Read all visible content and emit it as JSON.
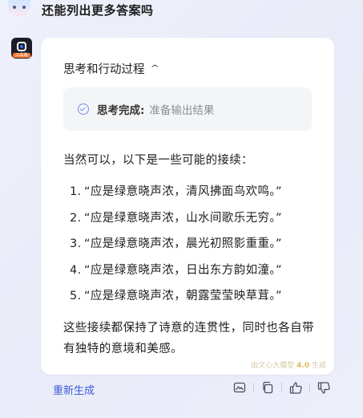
{
  "user_message": {
    "text": "还能列出更多答案吗"
  },
  "bot": {
    "avatar_tag": "工具版"
  },
  "thinking": {
    "header": "思考和行动过程",
    "status_label": "思考完成:",
    "status_value": "准备输出结果"
  },
  "answer": {
    "intro": "当然可以，以下是一些可能的接续：",
    "items": [
      {
        "num": "1.",
        "text": "“应是绿意晓声浓，清风拂面鸟欢鸣。”"
      },
      {
        "num": "2.",
        "text": "“应是绿意晓声浓，山水间歌乐无穷。”"
      },
      {
        "num": "3.",
        "text": "“应是绿意晓声浓，晨光初照影重重。”"
      },
      {
        "num": "4.",
        "text": "“应是绿意晓声浓，日出东方韵如潼。”"
      },
      {
        "num": "5.",
        "text": "“应是绿意晓声浓，朝露莹莹映草茸。”"
      }
    ],
    "summary": "这些接续都保持了诗意的连贯性，同时也各自带有独特的意境和美感。",
    "watermark_prefix": "由文心大模型",
    "watermark_version": "4.0",
    "watermark_suffix": "生成"
  },
  "actions": {
    "regenerate": "重新生成",
    "icons": [
      "image-icon",
      "copy-icon",
      "thumbs-up-icon",
      "thumbs-down-icon"
    ]
  },
  "colors": {
    "accent": "#3b5bdb",
    "check": "#7a8cf0",
    "avatar_bg": "#1c1c28",
    "avatar_tag": "#ff7a2e"
  }
}
